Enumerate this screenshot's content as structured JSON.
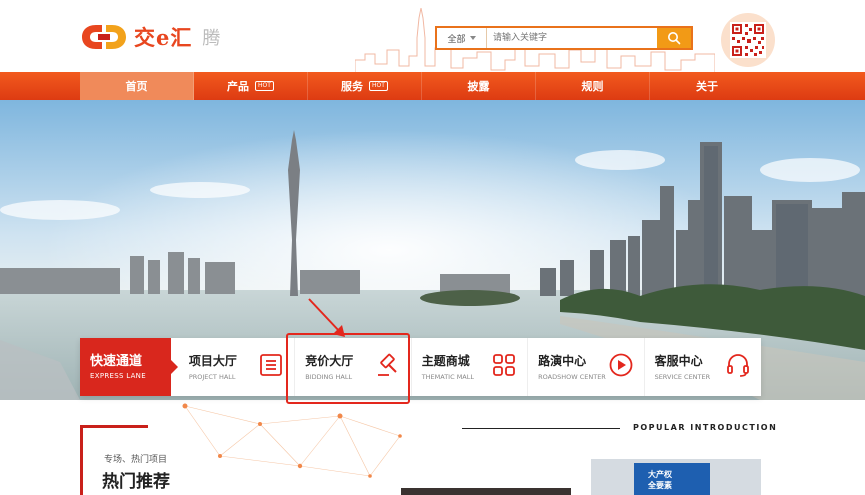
{
  "header": {
    "logo_text": "交e汇",
    "logo_sub": "腾",
    "search": {
      "category": "全部",
      "placeholder": "请输入关键字"
    }
  },
  "nav": {
    "items": [
      {
        "label": "首页",
        "active": true,
        "hot": false
      },
      {
        "label": "产品",
        "active": false,
        "hot": true
      },
      {
        "label": "服务",
        "active": false,
        "hot": true
      },
      {
        "label": "披露",
        "active": false,
        "hot": false
      },
      {
        "label": "规则",
        "active": false,
        "hot": false
      },
      {
        "label": "关于",
        "active": false,
        "hot": false
      }
    ],
    "hot_badge": "HOT"
  },
  "quick_lane": {
    "title": "快速通道",
    "subtitle": "EXPRESS LANE",
    "items": [
      {
        "zh": "项目大厅",
        "en": "PROJECT HALL",
        "icon": "document-list-icon"
      },
      {
        "zh": "竞价大厅",
        "en": "BIDDING HALL",
        "icon": "gavel-icon"
      },
      {
        "zh": "主题商城",
        "en": "THEMATIC MALL",
        "icon": "grid-icon"
      },
      {
        "zh": "路演中心",
        "en": "ROADSHOW CENTER",
        "icon": "play-icon"
      },
      {
        "zh": "客服中心",
        "en": "SERVICE CENTER",
        "icon": "headset-icon"
      }
    ]
  },
  "hot_section": {
    "subtitle": "专场、热门项目",
    "title": "热门推荐"
  },
  "popular": {
    "title": "POPULAR INTRODUCTION",
    "book_line1": "大产权",
    "book_line2": "全要素"
  },
  "colors": {
    "brand_red": "#d9271d",
    "nav_orange": "#f25a1e",
    "search_orange": "#f29a16"
  }
}
